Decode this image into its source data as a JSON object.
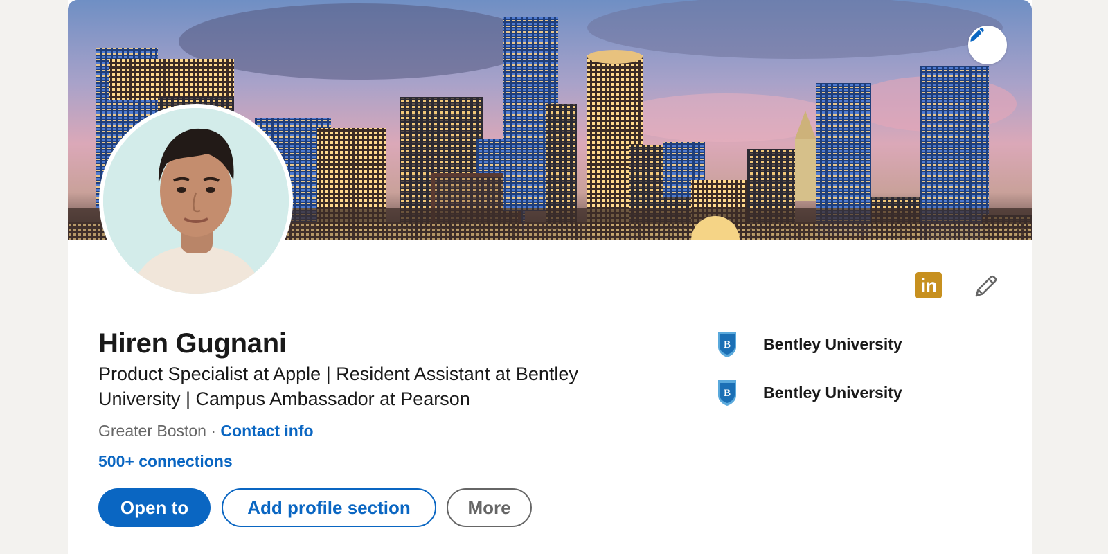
{
  "profile": {
    "name": "Hiren Gugnani",
    "headline": "Product Specialist at Apple | Resident Assistant at Bentley University | Campus Ambassador at Pearson",
    "location": "Greater Boston",
    "separator": "·",
    "contact_link": "Contact info",
    "connections": "500+ connections"
  },
  "actions": {
    "open_to": "Open to",
    "add_section": "Add profile section",
    "more": "More"
  },
  "education": [
    {
      "name": "Bentley University",
      "logo": "bentley-shield-icon",
      "logo_letter": "B"
    },
    {
      "name": "Bentley University",
      "logo": "bentley-shield-icon",
      "logo_letter": "B"
    }
  ],
  "icons": {
    "cover_edit": "pencil-icon",
    "linkedin_badge": "linkedin-in-icon",
    "linkedin_text": "in",
    "intro_edit": "pencil-icon"
  },
  "colors": {
    "brand_blue": "#0a66c2",
    "linkedin_gold": "#c7901f",
    "background": "#f3f2ef"
  }
}
